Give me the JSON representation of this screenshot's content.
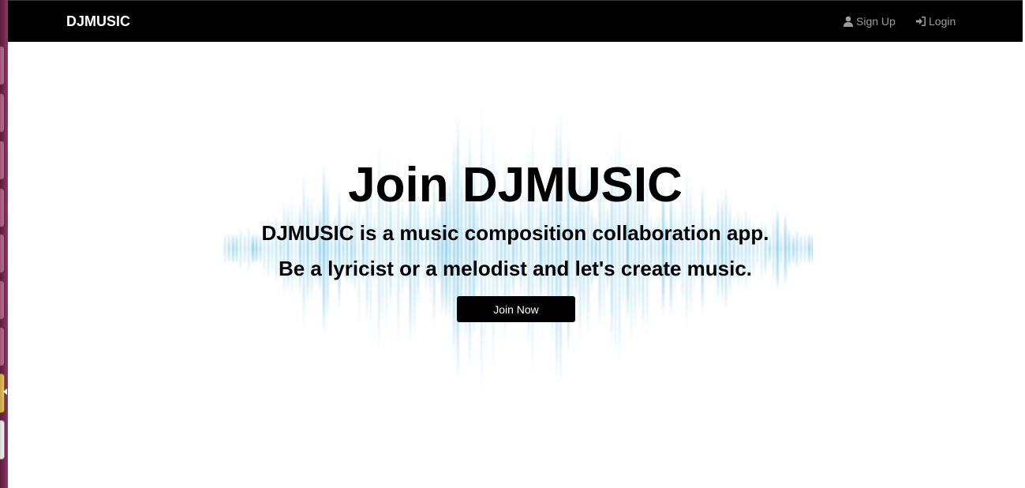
{
  "navbar": {
    "brand": "DJMUSIC",
    "links": [
      {
        "label": "Sign Up",
        "icon": "user-icon"
      },
      {
        "label": "Login",
        "icon": "login-icon"
      }
    ]
  },
  "hero": {
    "title": "Join DJMUSIC",
    "subtitle_line1": "DJMUSIC is a music composition collaboration app.",
    "subtitle_line2": "Be a lyricist or a melodist and let's create music.",
    "button_label": "Join Now",
    "background": "audio-waveform"
  },
  "colors": {
    "navbar_bg": "#000000",
    "brand_text": "#ffffff",
    "nav_link_text": "#9d9d9d",
    "wave_color": "#5bb8dd",
    "button_bg": "#000000",
    "button_text": "#ffffff"
  }
}
